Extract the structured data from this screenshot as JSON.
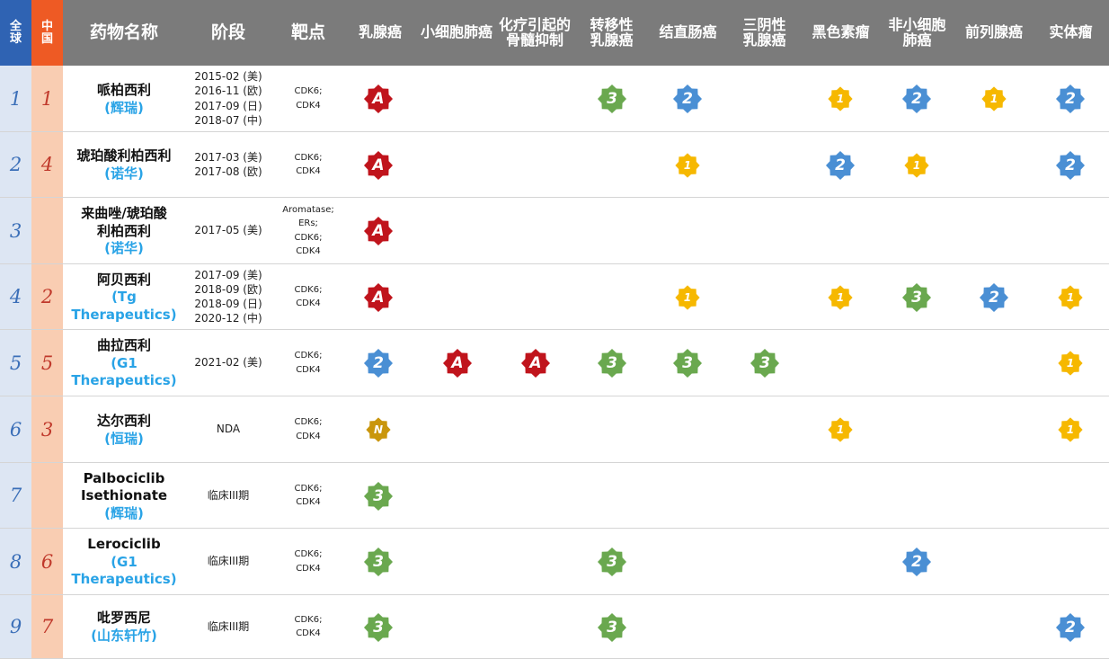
{
  "header": {
    "rank_global": [
      "全",
      "球"
    ],
    "rank_china": [
      "中",
      "国"
    ],
    "drug_name": "药物名称",
    "stage": "阶段",
    "target": "靶点",
    "indications": [
      [
        "乳腺癌"
      ],
      [
        "小细胞肺癌"
      ],
      [
        "化疗引起的",
        "骨髓抑制"
      ],
      [
        "转移性",
        "乳腺癌"
      ],
      [
        "结直肠癌"
      ],
      [
        "三阴性",
        "乳腺癌"
      ],
      [
        "黑色素瘤"
      ],
      [
        "非小细胞",
        "肺癌"
      ],
      [
        "前列腺癌"
      ],
      [
        "实体瘤"
      ]
    ]
  },
  "legend_colors": {
    "A": "#c0141c",
    "N": "#c9960c",
    "3": "#6aa84f",
    "2": "#4a8fd4",
    "1": "#f6b800"
  },
  "rows": [
    {
      "global": "1",
      "china": "1",
      "name": [
        "哌柏西利"
      ],
      "company": [
        "(辉瑞)"
      ],
      "stage": [
        "2015-02 (美)",
        "2016-11 (欧)",
        "2017-09 (日)",
        "2018-07 (中)"
      ],
      "target": [
        "CDK6;",
        "CDK4"
      ],
      "badges": [
        "A",
        "",
        "",
        "3",
        "2",
        "",
        "1",
        "2",
        "1",
        "2"
      ]
    },
    {
      "global": "2",
      "china": "4",
      "name": [
        "琥珀酸利柏西利"
      ],
      "company": [
        "(诺华)"
      ],
      "stage": [
        "2017-03 (美)",
        "2017-08 (欧)"
      ],
      "target": [
        "CDK6;",
        "CDK4"
      ],
      "badges": [
        "A",
        "",
        "",
        "",
        "1",
        "",
        "2",
        "1",
        "",
        "2"
      ]
    },
    {
      "global": "3",
      "china": "",
      "name": [
        "来曲唑/琥珀酸",
        "利柏西利"
      ],
      "company": [
        "(诺华)"
      ],
      "stage": [
        "2017-05 (美)"
      ],
      "target": [
        "Aromatase;",
        "ERs;",
        "CDK6;",
        "CDK4"
      ],
      "badges": [
        "A",
        "",
        "",
        "",
        "",
        "",
        "",
        "",
        "",
        ""
      ]
    },
    {
      "global": "4",
      "china": "2",
      "name": [
        "阿贝西利"
      ],
      "company": [
        "(Tg",
        "Therapeutics)"
      ],
      "stage": [
        "2017-09 (美)",
        "2018-09 (欧)",
        "2018-09 (日)",
        "2020-12 (中)"
      ],
      "target": [
        "CDK6;",
        "CDK4"
      ],
      "badges": [
        "A",
        "",
        "",
        "",
        "1",
        "",
        "1",
        "3",
        "2",
        "1"
      ]
    },
    {
      "global": "5",
      "china": "5",
      "name": [
        "曲拉西利"
      ],
      "company": [
        "(G1",
        "Therapeutics)"
      ],
      "stage": [
        "2021-02 (美)"
      ],
      "target": [
        "CDK6;",
        "CDK4"
      ],
      "badges": [
        "2",
        "A",
        "A",
        "3",
        "3",
        "3",
        "",
        "",
        "",
        "1"
      ]
    },
    {
      "global": "6",
      "china": "3",
      "name": [
        "达尔西利"
      ],
      "company": [
        "(恒瑞)"
      ],
      "stage": [
        "NDA"
      ],
      "target": [
        "CDK6;",
        "CDK4"
      ],
      "badges": [
        "N",
        "",
        "",
        "",
        "",
        "",
        "1",
        "",
        "",
        "1"
      ]
    },
    {
      "global": "7",
      "china": "",
      "name": [
        "Palbociclib",
        "Isethionate"
      ],
      "company": [
        "(辉瑞)"
      ],
      "stage": [
        "临床III期"
      ],
      "target": [
        "CDK6;",
        "CDK4"
      ],
      "badges": [
        "3",
        "",
        "",
        "",
        "",
        "",
        "",
        "",
        "",
        ""
      ]
    },
    {
      "global": "8",
      "china": "6",
      "name": [
        "Lerociclib"
      ],
      "company": [
        "(G1",
        "Therapeutics)"
      ],
      "stage": [
        "临床III期"
      ],
      "target": [
        "CDK6;",
        "CDK4"
      ],
      "badges": [
        "3",
        "",
        "",
        "3",
        "",
        "",
        "",
        "2",
        "",
        ""
      ]
    },
    {
      "global": "9",
      "china": "7",
      "name": [
        "吡罗西尼"
      ],
      "company": [
        "(山东轩竹)"
      ],
      "stage": [
        "临床III期"
      ],
      "target": [
        "CDK6;",
        "CDK4"
      ],
      "badges": [
        "3",
        "",
        "",
        "3",
        "",
        "",
        "",
        "",
        "",
        "2"
      ]
    }
  ]
}
